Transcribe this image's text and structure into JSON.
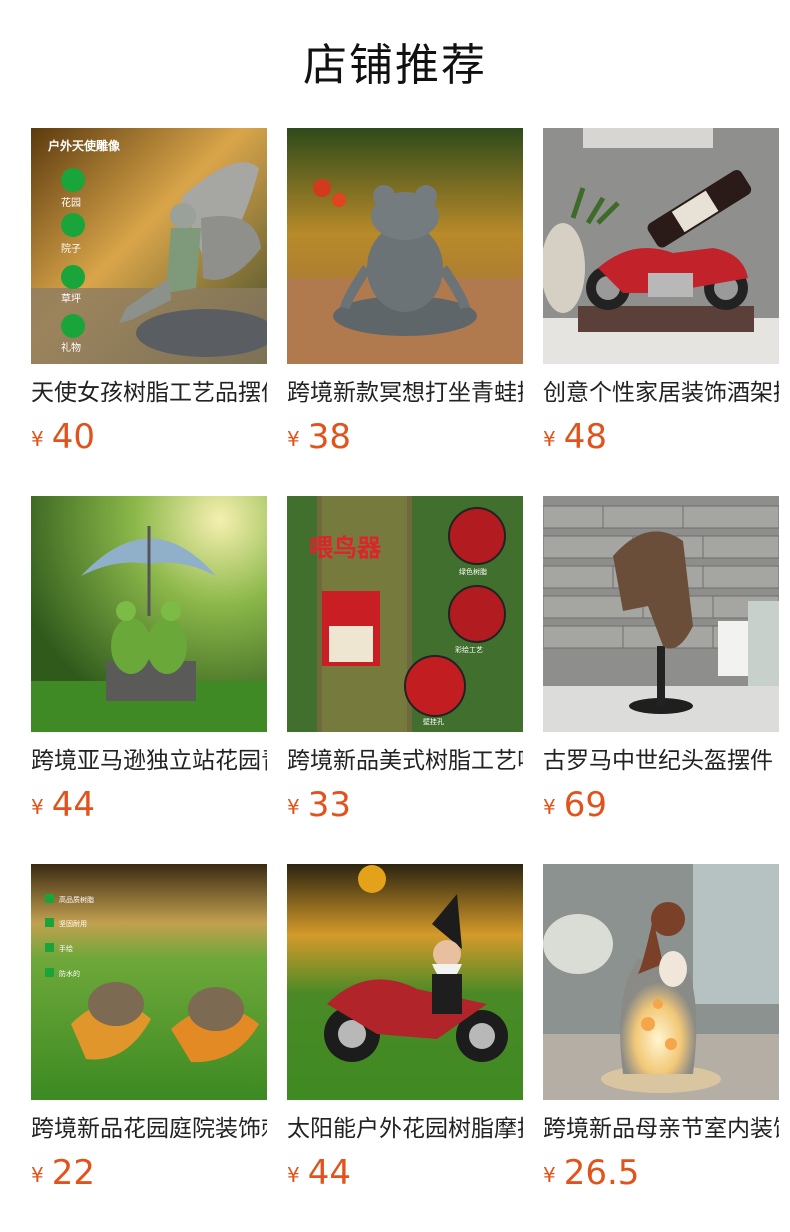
{
  "section": {
    "title": "店铺推荐"
  },
  "theme": {
    "price_color": "#e2531c"
  },
  "products": [
    {
      "name": "天使女孩树脂工艺品摆件",
      "currency": "¥",
      "price": "40",
      "image": "angel-fairy-statue",
      "overlay": {
        "heading": "户外天使雕像",
        "tags": [
          "花园",
          "院子",
          "草坪",
          "礼物"
        ]
      }
    },
    {
      "name": "跨境新款冥想打坐青蛙摆件",
      "currency": "¥",
      "price": "38",
      "image": "meditating-frog-statue"
    },
    {
      "name": "创意个性家居装饰酒架摆件",
      "currency": "¥",
      "price": "48",
      "image": "motorcycle-wine-rack"
    },
    {
      "name": "跨境亚马逊独立站花园青蛙",
      "currency": "¥",
      "price": "44",
      "image": "frogs-under-umbrella"
    },
    {
      "name": "跨境新品美式树脂工艺喂鸟器",
      "currency": "¥",
      "price": "33",
      "image": "bird-feeder-mailbox",
      "overlay": {
        "heading": "喂鸟器",
        "callouts": [
          "绿色树脂",
          "彩绘工艺",
          "壁挂孔"
        ]
      }
    },
    {
      "name": "古罗马中世纪头盔摆件",
      "currency": "¥",
      "price": "69",
      "image": "roman-helmet-bust"
    },
    {
      "name": "跨境新品花园庭院装饰刺猬",
      "currency": "¥",
      "price": "22",
      "image": "hedgehogs-on-leaves",
      "overlay": {
        "checks": [
          "高品质树脂",
          "坚固耐用",
          "手绘",
          "防水的"
        ]
      }
    },
    {
      "name": "太阳能户外花园树脂摩托侏儒",
      "currency": "¥",
      "price": "44",
      "image": "gnome-on-motorcycle"
    },
    {
      "name": "跨境新品母亲节室内装饰灯",
      "currency": "¥",
      "price": "26.5",
      "image": "mother-child-lamp"
    }
  ]
}
